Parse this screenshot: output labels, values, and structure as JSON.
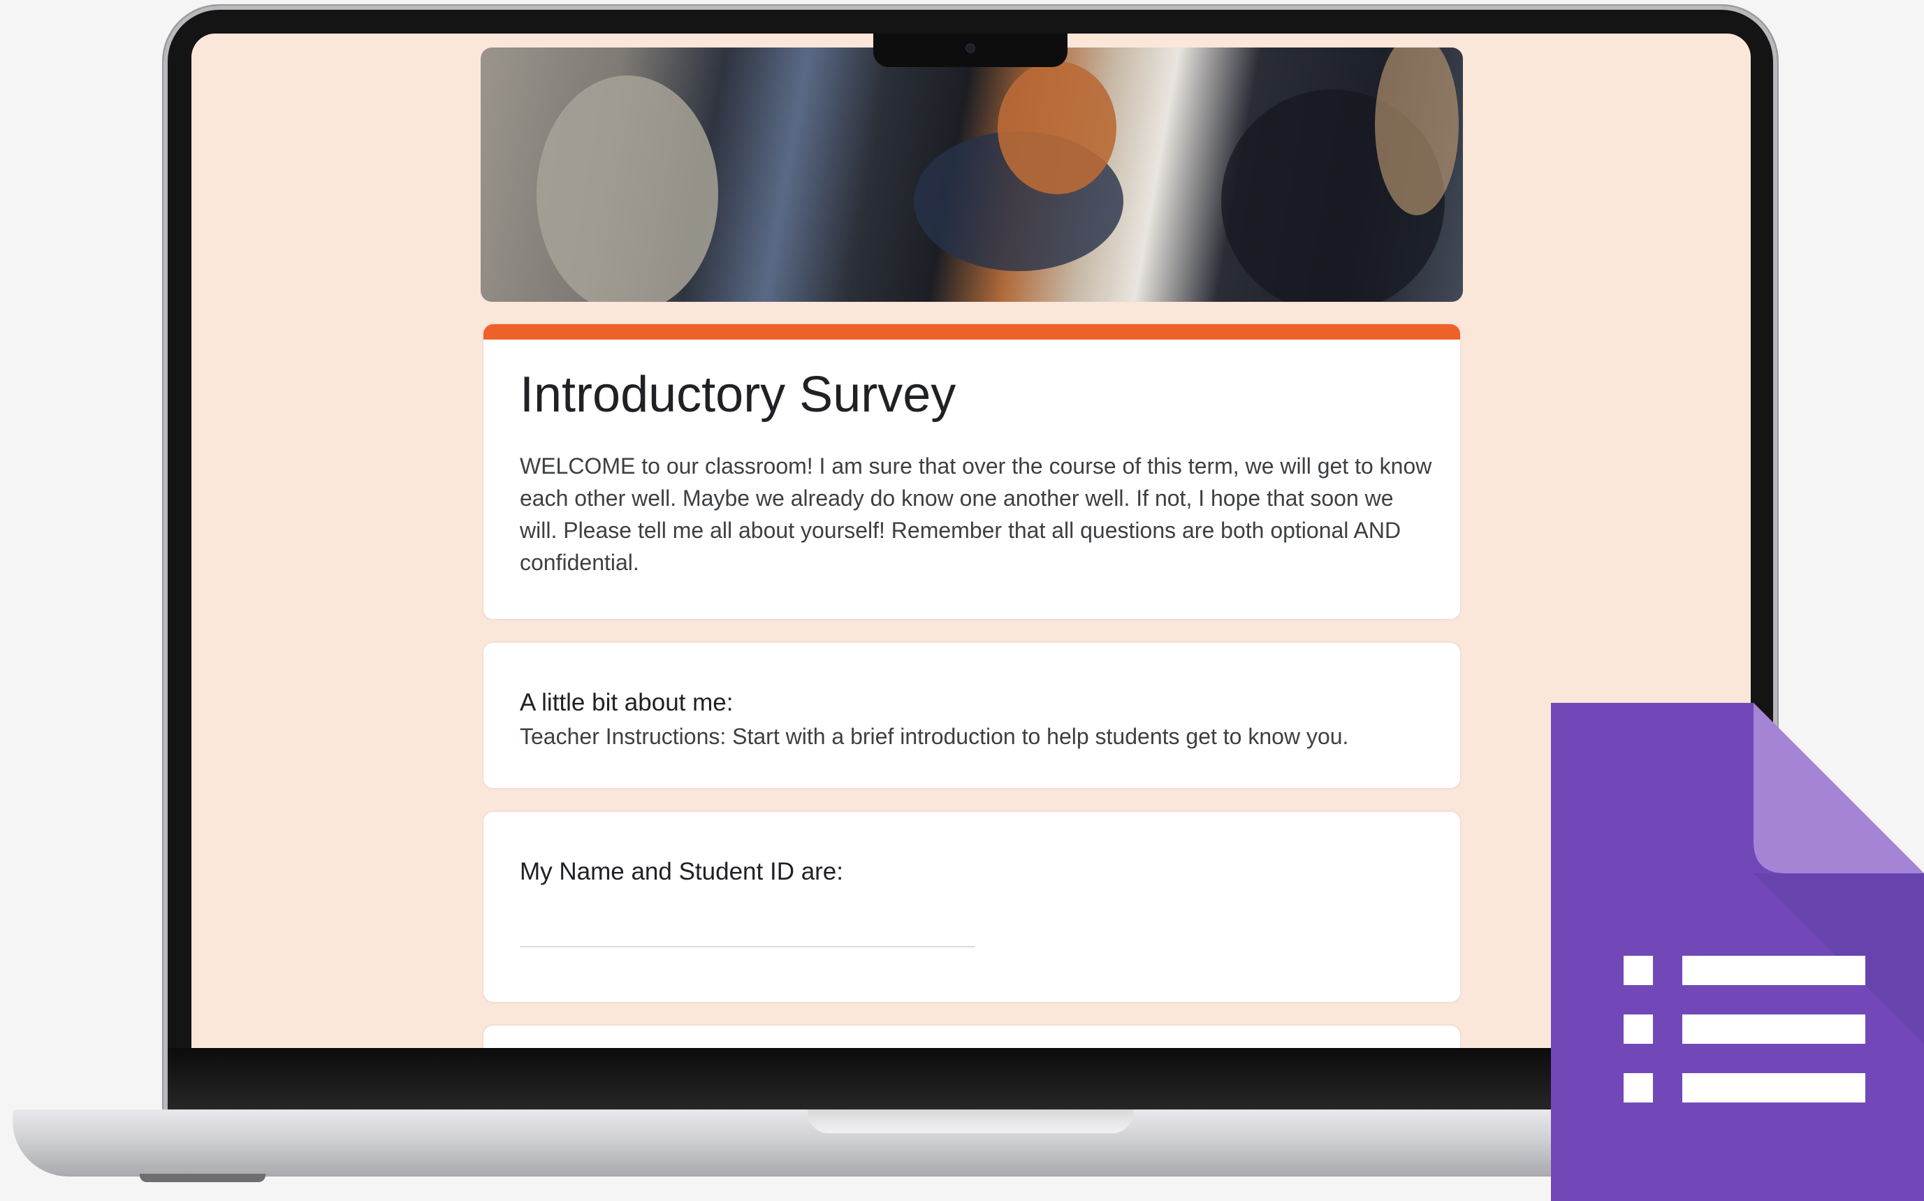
{
  "form": {
    "title": "Introductory Survey",
    "description": "WELCOME to our classroom! I am sure that over the course of this term, we will get to know each other well. Maybe we already do know one another well. If not, I hope that soon we will. Please tell me all about yourself! Remember that all questions are both optional AND confidential.",
    "accent_color": "#ee6129",
    "background_color": "#fbe6da"
  },
  "section": {
    "title": "A little bit about me:",
    "subtitle": "Teacher Instructions: Start with a brief introduction to help students get to know you."
  },
  "question": {
    "label": "My Name and Student ID are:",
    "value": ""
  },
  "overlay_icon": {
    "name": "google-forms-icon",
    "color_primary": "#7248b9",
    "color_fold": "#a584d6"
  }
}
